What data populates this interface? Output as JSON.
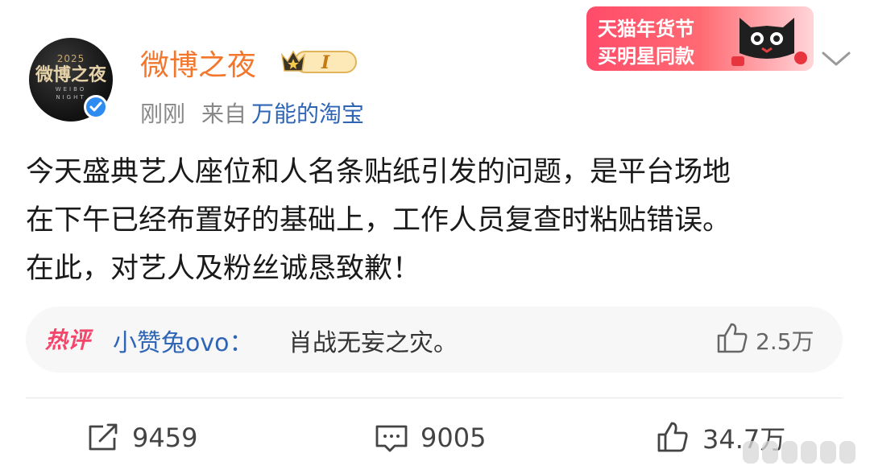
{
  "post": {
    "avatar": {
      "year": "2025",
      "main": "微博之夜",
      "sub": "WEIBO NIGHT"
    },
    "username": "微博之夜",
    "vip_level": "I",
    "time": "刚刚",
    "source_prefix": "来自",
    "source_name": "万能的淘宝",
    "content_lines": [
      "今天盛典艺人座位和人名条贴纸引发的问题，是平台场地",
      "在下午已经布置好的基础上，工作人员复查时粘贴错误。",
      "在此，对艺人及粉丝诚恳致歉！"
    ]
  },
  "ad": {
    "line1": "天猫年货节",
    "line2": "买明星同款"
  },
  "hot_comment": {
    "badge": "热评",
    "user": "小赞兔ovo",
    "separator": "：",
    "text": "肖战无妄之灾。",
    "likes": "2.5万"
  },
  "actions": {
    "repost_count": "9459",
    "comment_count": "9005",
    "like_count": "34.7万"
  },
  "colors": {
    "username": "#f2772d",
    "link": "#2f65b5",
    "hot_badge": "#f3466b",
    "verified": "#2e8bf0"
  }
}
